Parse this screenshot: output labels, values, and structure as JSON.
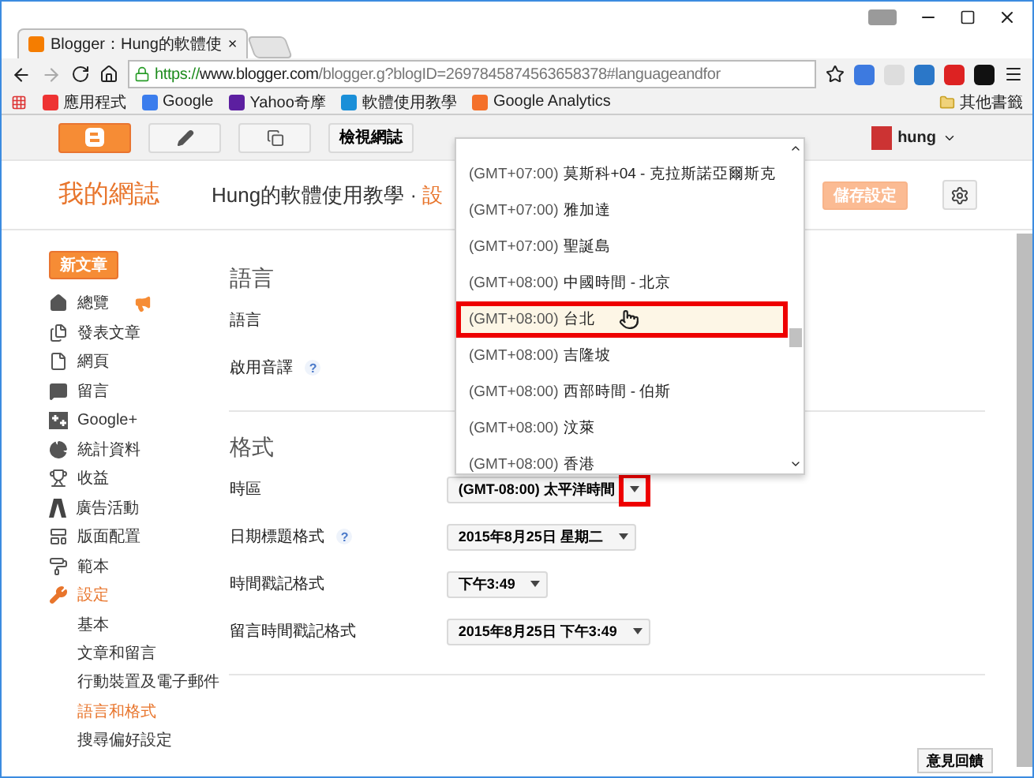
{
  "browser": {
    "tab": {
      "title": "Blogger：Hung的軟體使",
      "close": "×"
    },
    "url": {
      "scheme": "https://",
      "host": "www.blogger.com",
      "path": "/blogger.g?blogID=2697845874563658378#languageandfor"
    },
    "bookmarks": [
      "應用程式",
      "Google",
      "Yahoo奇摩",
      "軟體使用教學",
      "Google Analytics"
    ],
    "other_bookmarks": "其他書籤"
  },
  "blogger_bar": {
    "view_blog": "檢視網誌",
    "user": "hung"
  },
  "header": {
    "app_title": "我的網誌",
    "blog_title": "Hung的軟體使用教學",
    "separator": "·",
    "crumb": "設",
    "save": "儲存設定",
    "save_disabled": true
  },
  "sidebar": {
    "new_post": "新文章",
    "items": [
      {
        "label": "總覽",
        "selected": false,
        "badge": true
      },
      {
        "label": "發表文章",
        "selected": false
      },
      {
        "label": "網頁",
        "selected": false
      },
      {
        "label": "留言",
        "selected": false
      },
      {
        "label": "Google+",
        "selected": false
      },
      {
        "label": "統計資料",
        "selected": false
      },
      {
        "label": "收益",
        "selected": false
      },
      {
        "label": "廣告活動",
        "selected": false
      },
      {
        "label": "版面配置",
        "selected": false
      },
      {
        "label": "範本",
        "selected": false
      },
      {
        "label": "設定",
        "selected": true,
        "children": [
          {
            "label": "基本",
            "selected": false
          },
          {
            "label": "文章和留言",
            "selected": false
          },
          {
            "label": "行動裝置及電子郵件",
            "selected": false
          },
          {
            "label": "語言和格式",
            "selected": true
          },
          {
            "label": "搜尋偏好設定",
            "selected": false
          }
        ]
      }
    ]
  },
  "sections": [
    {
      "title": "語言",
      "rows": [
        {
          "label": "語言"
        },
        {
          "label": "啟用音譯",
          "help_text": "?"
        }
      ]
    },
    {
      "title": "格式",
      "rows": [
        {
          "label": "時區",
          "value": "(GMT-08:00) 太平洋時間",
          "caret_highlighted": true
        },
        {
          "label": "日期標題格式",
          "help_text": "?",
          "value": "2015年8月25日 星期二",
          "caret_highlighted": false
        },
        {
          "label": "時間戳記格式",
          "value": "下午3:49",
          "caret_highlighted": false
        },
        {
          "label": "留言時間戳記格式",
          "value": "2015年8月25日 下午3:49",
          "caret_highlighted": false
        }
      ]
    }
  ],
  "timezone_dropdown": {
    "options": [
      {
        "offset": "(GMT+07:00)",
        "name": "莫斯科+04 - 克拉斯諾亞爾斯克",
        "selected": false
      },
      {
        "offset": "(GMT+07:00)",
        "name": "雅加達",
        "selected": false
      },
      {
        "offset": "(GMT+07:00)",
        "name": "聖誕島",
        "selected": false
      },
      {
        "offset": "(GMT+08:00)",
        "name": "中國時間 - 北京",
        "selected": false
      },
      {
        "offset": "(GMT+08:00)",
        "name": "台北",
        "selected": true
      },
      {
        "offset": "(GMT+08:00)",
        "name": "吉隆坡",
        "selected": false
      },
      {
        "offset": "(GMT+08:00)",
        "name": "西部時間 - 伯斯",
        "selected": false
      },
      {
        "offset": "(GMT+08:00)",
        "name": "汶萊",
        "selected": false
      },
      {
        "offset": "(GMT+08:00)",
        "name": "香港",
        "selected": false
      }
    ]
  },
  "feedback": "意見回饋"
}
